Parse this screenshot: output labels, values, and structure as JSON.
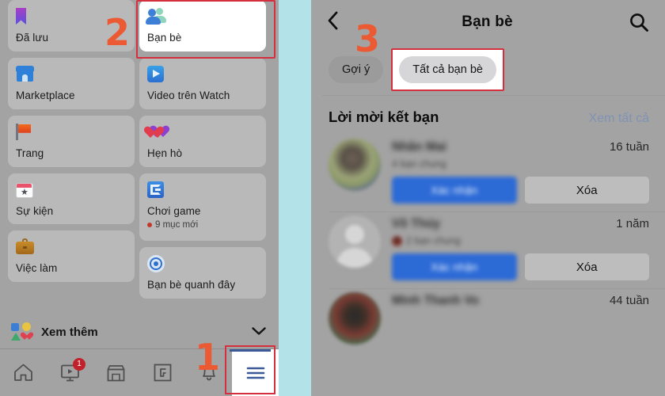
{
  "left_panel": {
    "menu_tiles_left_column": [
      {
        "label": "Đã lưu",
        "icon": "bookmark-icon"
      },
      {
        "label": "Marketplace",
        "icon": "marketplace-shop-icon"
      },
      {
        "label": "Trang",
        "icon": "flag-icon"
      },
      {
        "label": "Sự kiện",
        "icon": "calendar-star-icon"
      },
      {
        "label": "Việc làm",
        "icon": "briefcase-icon"
      }
    ],
    "menu_tiles_right_column": [
      {
        "label": "Bạn bè",
        "icon": "friends-icon",
        "highlighted": true
      },
      {
        "label": "Video trên Watch",
        "icon": "watch-play-icon"
      },
      {
        "label": "Hẹn hò",
        "icon": "dating-hearts-icon"
      },
      {
        "label": "Chơi game",
        "icon": "gaming-icon",
        "sub": "9 mục mới",
        "sub_dot_color": "#c0392b"
      },
      {
        "label": "Bạn bè quanh đây",
        "icon": "nearby-friends-icon"
      }
    ],
    "see_more": {
      "label": "Xem thêm",
      "chevron": "chevron-down-icon"
    },
    "bottom_nav": [
      {
        "name": "home",
        "icon": "home-icon",
        "badge": ""
      },
      {
        "name": "watch",
        "icon": "video-play-icon",
        "badge": "1"
      },
      {
        "name": "marketplace",
        "icon": "shop-outline-icon",
        "badge": ""
      },
      {
        "name": "gaming",
        "icon": "gaming-outline-icon",
        "badge": ""
      },
      {
        "name": "notifications",
        "icon": "bell-icon",
        "badge": ""
      },
      {
        "name": "menu",
        "icon": "hamburger-menu-icon",
        "badge": "",
        "active": true
      }
    ]
  },
  "right_panel": {
    "header": {
      "back": "back-chevron-icon",
      "title": "Bạn bè",
      "search": "search-icon"
    },
    "tabs": [
      {
        "label": "Gợi ý",
        "selected": false
      },
      {
        "label": "Tất cả bạn bè",
        "selected": true,
        "highlighted": true
      }
    ],
    "section": {
      "title": "Lời mời kết bạn",
      "see_all": "Xem tất cả"
    },
    "friend_requests": [
      {
        "name": "Nhân Mai",
        "name_blurred": true,
        "mutual": "4 bạn chung",
        "time": "16 tuần",
        "confirm_label": "Xác nhận",
        "delete_label": "Xóa",
        "avatar": "photo"
      },
      {
        "name": "Võ Thúy",
        "name_blurred": true,
        "mutual": "2 bạn chung",
        "time": "1 năm",
        "confirm_label": "Xác nhận",
        "delete_label": "Xóa",
        "avatar": "silhouette"
      },
      {
        "name": "Minh Thanh Vo",
        "name_blurred": true,
        "mutual": "",
        "time": "44 tuần",
        "confirm_label": "Xác nhận",
        "delete_label": "Xóa",
        "avatar": "dark"
      }
    ]
  },
  "annotations": {
    "step_1": "1",
    "step_2": "2",
    "step_3": "3",
    "color": "#eb5a33",
    "highlight_box_color": "#d32f3f"
  },
  "colors": {
    "dim_overlay": "#a3a3a3",
    "tile_bg": "#b9b9b9",
    "divider_strip": "#b3e2e8",
    "facebook_blue": "#2c6ad6",
    "link_blue": "#7f93b5",
    "badge_red": "#c0212b"
  }
}
